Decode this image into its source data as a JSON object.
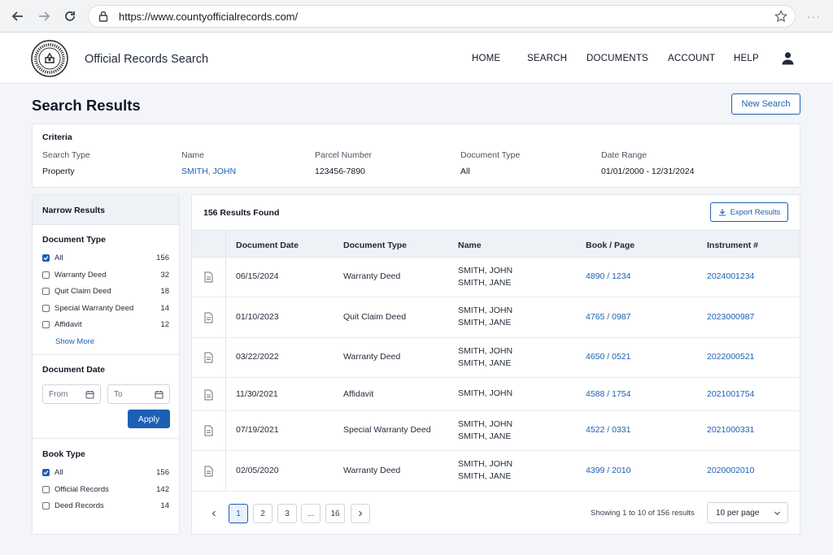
{
  "browser": {
    "url": "https://www.countyofficialrecords.com/"
  },
  "header": {
    "site_title": "Official Records Search",
    "logo_icon": "county-seal-icon",
    "nav": [
      {
        "label": "HOME"
      },
      {
        "label": "SEARCH"
      },
      {
        "label": "DOCUMENTS"
      },
      {
        "label": "ACCOUNT"
      },
      {
        "label": "HELP"
      }
    ]
  },
  "page": {
    "title": "Search Results",
    "new_search_label": "New Search"
  },
  "criteria": {
    "heading": "Criteria",
    "fields": [
      {
        "label": "Search Type",
        "value": "Property"
      },
      {
        "label": "Name",
        "value": "SMITH, JOHN"
      },
      {
        "label": "Parcel Number",
        "value": "123456-7890"
      },
      {
        "label": "Document Type",
        "value": "All"
      },
      {
        "label": "Date Range",
        "value": "01/01/2000 - 12/31/2024"
      }
    ]
  },
  "sidebar": {
    "title": "Narrow Results",
    "document_type": {
      "title": "Document Type",
      "options": [
        {
          "label": "All",
          "count": "156",
          "checked": true
        },
        {
          "label": "Warranty Deed",
          "count": "32",
          "checked": false
        },
        {
          "label": "Quit Claim Deed",
          "count": "18",
          "checked": false
        },
        {
          "label": "Special Warranty Deed",
          "count": "14",
          "checked": false
        },
        {
          "label": "Affidavit",
          "count": "12",
          "checked": false
        }
      ],
      "show_more": "Show More"
    },
    "document_date": {
      "title": "Document Date",
      "from_placeholder": "From",
      "to_placeholder": "To",
      "apply_label": "Apply"
    },
    "book_type": {
      "title": "Book Type",
      "options": [
        {
          "label": "All",
          "count": "156",
          "checked": true
        },
        {
          "label": "Official Records",
          "count": "142",
          "checked": false
        },
        {
          "label": "Deed Records",
          "count": "14",
          "checked": false
        }
      ]
    }
  },
  "results": {
    "count_text": "156 Results Found",
    "export_label": "Export Results",
    "columns": [
      "Document Date",
      "Document Type",
      "Name",
      "Book / Page",
      "Instrument #"
    ],
    "rows": [
      {
        "date": "06/15/2024",
        "type": "Warranty Deed",
        "names": [
          "SMITH, JOHN",
          "SMITH, JANE"
        ],
        "book_page": "4890 / 1234",
        "instrument": "2024001234"
      },
      {
        "date": "01/10/2023",
        "type": "Quit Claim Deed",
        "names": [
          "SMITH, JOHN",
          "SMITH, JANE"
        ],
        "book_page": "4765 / 0987",
        "instrument": "2023000987"
      },
      {
        "date": "03/22/2022",
        "type": "Warranty Deed",
        "names": [
          "SMITH, JOHN",
          "SMITH, JANE"
        ],
        "book_page": "4650 / 0521",
        "instrument": "2022000521"
      },
      {
        "date": "11/30/2021",
        "type": "Affidavit",
        "names": [
          "SMITH, JOHN"
        ],
        "book_page": "4588 / 1754",
        "instrument": "2021001754"
      },
      {
        "date": "07/19/2021",
        "type": "Special Warranty Deed",
        "names": [
          "SMITH, JOHN",
          "SMITH, JANE"
        ],
        "book_page": "4522 / 0331",
        "instrument": "2021000331"
      },
      {
        "date": "02/05/2020",
        "type": "Warranty Deed",
        "names": [
          "SMITH, JOHN",
          "SMITH, JANE"
        ],
        "book_page": "4399 / 2010",
        "instrument": "2020002010"
      }
    ],
    "pagination": {
      "pages": [
        "1",
        "2",
        "3",
        "...",
        "16"
      ],
      "current": "1",
      "summary": "Showing 1 to 10 of 156 results",
      "per_page": "10 per page"
    }
  },
  "colors": {
    "accent": "#1d5fb4",
    "background": "#f3f5f8",
    "header_bg": "#eef1f5"
  }
}
